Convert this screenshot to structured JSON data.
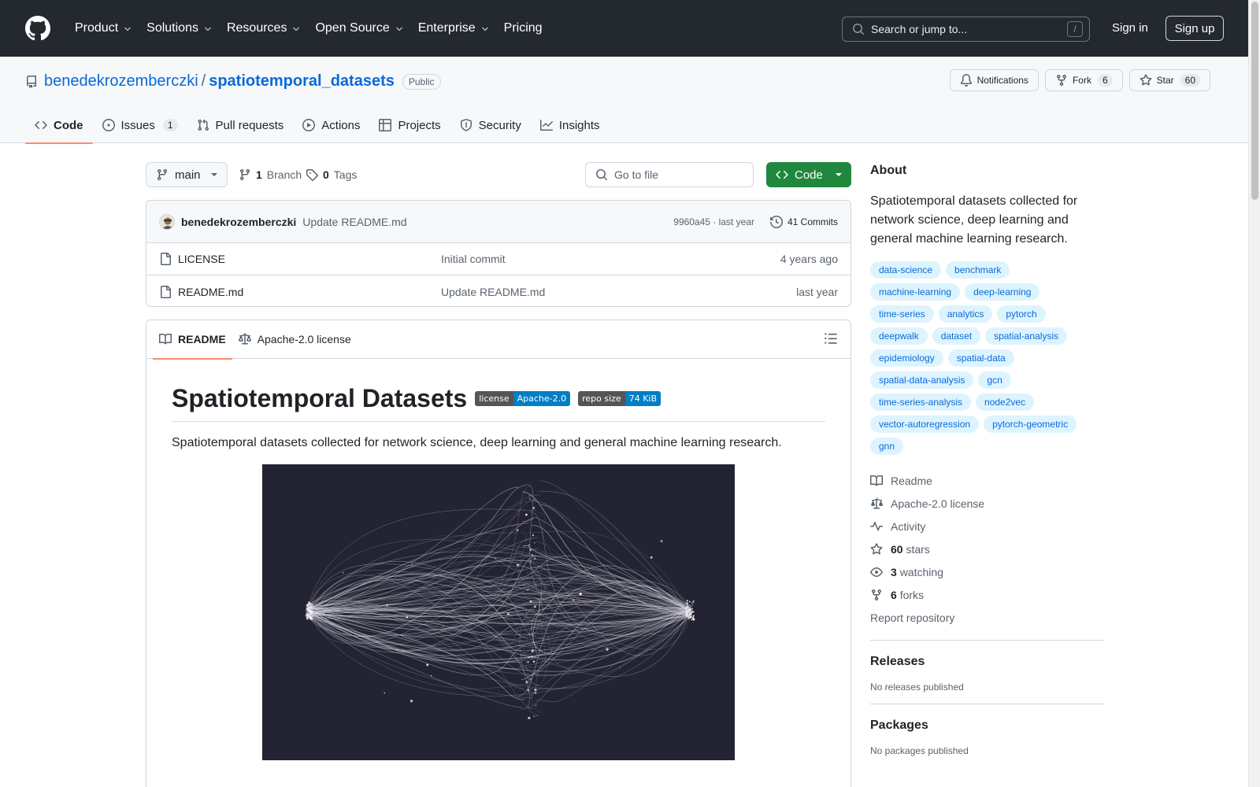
{
  "header": {
    "nav": [
      "Product",
      "Solutions",
      "Resources",
      "Open Source",
      "Enterprise",
      "Pricing"
    ],
    "search_placeholder": "Search or jump to...",
    "search_shortcut": "/",
    "sign_in": "Sign in",
    "sign_up": "Sign up"
  },
  "repo": {
    "owner": "benedekrozemberczki",
    "separator": "/",
    "name": "spatiotemporal_datasets",
    "visibility": "Public",
    "notifications_label": "Notifications",
    "fork_label": "Fork",
    "fork_count": "6",
    "star_label": "Star",
    "star_count": "60"
  },
  "tabs": [
    {
      "label": "Code",
      "icon": "code-icon"
    },
    {
      "label": "Issues",
      "icon": "issue-icon",
      "count": "1"
    },
    {
      "label": "Pull requests",
      "icon": "pull-request-icon"
    },
    {
      "label": "Actions",
      "icon": "play-icon"
    },
    {
      "label": "Projects",
      "icon": "table-icon"
    },
    {
      "label": "Security",
      "icon": "shield-icon"
    },
    {
      "label": "Insights",
      "icon": "graph-icon"
    }
  ],
  "toolbar": {
    "branch": "main",
    "branch_count": "1",
    "branch_label": "Branch",
    "tag_count": "0",
    "tag_label": "Tags",
    "go_to_file": "Go to file",
    "code_button": "Code"
  },
  "latest_commit": {
    "author": "benedekrozemberczki",
    "message": "Update README.md",
    "meta": "9960a45 · last year",
    "commits": "41 Commits"
  },
  "files": [
    {
      "name": "LICENSE",
      "message": "Initial commit",
      "time": "4 years ago"
    },
    {
      "name": "README.md",
      "message": "Update README.md",
      "time": "last year"
    }
  ],
  "readme": {
    "tab_readme": "README",
    "tab_license": "Apache-2.0 license",
    "title": "Spatiotemporal Datasets",
    "badges": [
      {
        "left": "license",
        "right": "Apache-2.0"
      },
      {
        "left": "repo size",
        "right": "74 KiB"
      }
    ],
    "description": "Spatiotemporal datasets collected for network science, deep learning and general machine learning research."
  },
  "sidebar": {
    "about_title": "About",
    "about_desc": "Spatiotemporal datasets collected for network science, deep learning and general machine learning research.",
    "topics": [
      "data-science",
      "benchmark",
      "machine-learning",
      "deep-learning",
      "time-series",
      "analytics",
      "pytorch",
      "deepwalk",
      "dataset",
      "spatial-analysis",
      "epidemiology",
      "spatial-data",
      "spatial-data-analysis",
      "gcn",
      "time-series-analysis",
      "node2vec",
      "vector-autoregression",
      "pytorch-geometric",
      "gnn"
    ],
    "readme": "Readme",
    "license": "Apache-2.0 license",
    "activity": "Activity",
    "stars_count": "60",
    "stars_label": "stars",
    "watching_count": "3",
    "watching_label": "watching",
    "forks_count": "6",
    "forks_label": "forks",
    "report": "Report repository",
    "releases_title": "Releases",
    "releases_text": "No releases published",
    "packages_title": "Packages",
    "packages_text": "No packages published"
  }
}
